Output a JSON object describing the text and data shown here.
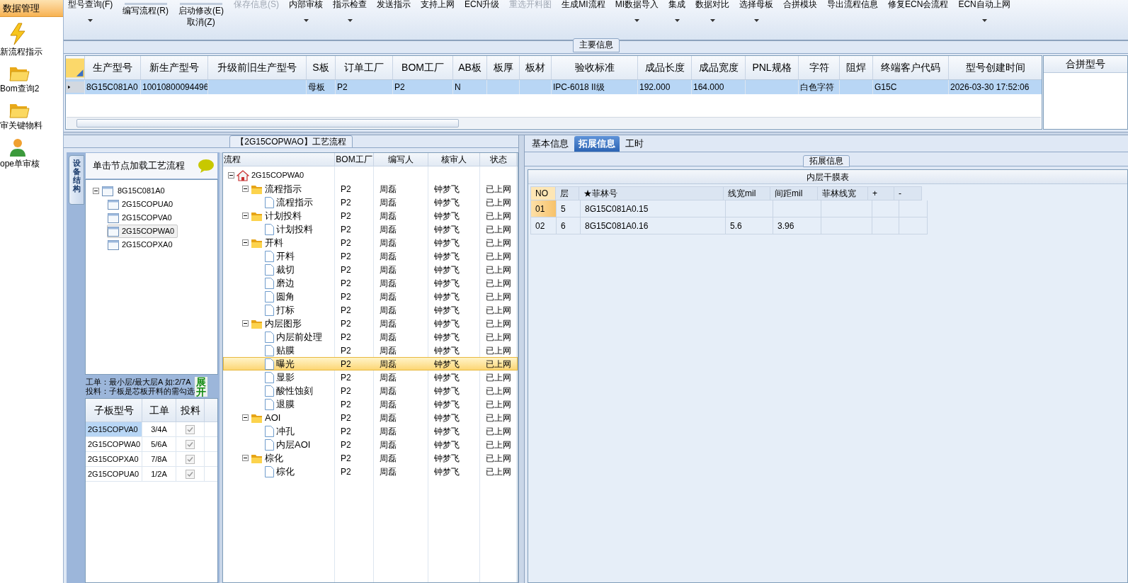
{
  "sidebar": {
    "header": "数据管理",
    "items": [
      {
        "label": "新流程指示"
      },
      {
        "label": "Bom查询2"
      },
      {
        "label": "审关键物料"
      },
      {
        "label": "ope单审核"
      }
    ]
  },
  "toolbar": [
    {
      "kind": "top",
      "label": "型号查询(F)",
      "dropdown": true,
      "disabled": false
    },
    {
      "kind": "mid",
      "lines": [
        "编写流程(R)"
      ],
      "dropdown": false,
      "disabled": false
    },
    {
      "kind": "mid",
      "lines": [
        "启动修改(E)",
        "取消(Z)"
      ],
      "dropdown": false,
      "disabled": false
    },
    {
      "kind": "top",
      "label": "保存信息(S)",
      "dropdown": false,
      "disabled": true
    },
    {
      "kind": "top",
      "label": "内部审核",
      "dropdown": true,
      "disabled": false
    },
    {
      "kind": "top",
      "label": "指示检查",
      "dropdown": true,
      "disabled": false
    },
    {
      "kind": "top",
      "label": "发送指示",
      "dropdown": false,
      "disabled": false
    },
    {
      "kind": "top",
      "label": "支持上网",
      "dropdown": false,
      "disabled": false
    },
    {
      "kind": "top",
      "label": "ECN升级",
      "dropdown": false,
      "disabled": false
    },
    {
      "kind": "top",
      "label": "重选开料图",
      "dropdown": false,
      "disabled": true
    },
    {
      "kind": "top",
      "label": "生成MI流程",
      "dropdown": false,
      "disabled": false
    },
    {
      "kind": "top",
      "label": "MI数据导入",
      "dropdown": true,
      "disabled": false
    },
    {
      "kind": "top",
      "label": "集成",
      "dropdown": true,
      "disabled": false
    },
    {
      "kind": "top",
      "label": "数据对比",
      "dropdown": true,
      "disabled": false
    },
    {
      "kind": "top",
      "label": "选择母板",
      "dropdown": true,
      "disabled": false
    },
    {
      "kind": "top",
      "label": "合拼模块",
      "dropdown": false,
      "disabled": false
    },
    {
      "kind": "top",
      "label": "导出流程信息",
      "dropdown": false,
      "disabled": false
    },
    {
      "kind": "top",
      "label": "修复ECN会流程",
      "dropdown": false,
      "disabled": false
    },
    {
      "kind": "top",
      "label": "ECN自动上网",
      "dropdown": true,
      "disabled": false
    }
  ],
  "main_info": {
    "title": "主要信息",
    "columns": [
      "生产型号",
      "新生产型号",
      "升级前旧生产型号",
      "S板",
      "订单工厂",
      "BOM工厂",
      "AB板",
      "板厚",
      "板材",
      "验收标准",
      "成品长度",
      "成品宽度",
      "PNL规格",
      "字符",
      "阻焊",
      "终端客户代码",
      "型号创建时间"
    ],
    "rows": [
      {
        "selected": true,
        "cells": [
          "8G15C081A0",
          "10010800094496",
          "",
          "母板",
          "P2",
          "P2",
          "N",
          "",
          "",
          "IPC-6018 II级",
          "192.000",
          "164.000",
          "",
          "白色字符",
          "",
          "G15C",
          "2026-03-30 17:52:06"
        ]
      }
    ],
    "side_title": "合拼型号"
  },
  "flow_panel": {
    "title": "【2G15COPWAO】工艺流程",
    "side_tab": "设备结构",
    "hint": "单击节点加载工艺流程",
    "tree": {
      "label": "8G15C081A0",
      "expanded": true,
      "children": [
        {
          "label": "2G15COPUA0",
          "selected": false
        },
        {
          "label": "2G15COPVA0",
          "selected": false
        },
        {
          "label": "2G15COPWA0",
          "selected": true
        },
        {
          "label": "2G15COPXA0",
          "selected": false
        }
      ]
    },
    "notes": [
      "工单：最小层/最大层A 如:2/7A",
      "投料：子板是芯板开料的需勾选"
    ],
    "expand_button": "展开",
    "sub_columns": [
      "子板型号",
      "工单",
      "投料"
    ],
    "sub_rows": [
      {
        "board": "2G15COPVA0",
        "order": "3/4A",
        "checked": true,
        "selected": true
      },
      {
        "board": "2G15COPWA0",
        "order": "5/6A",
        "checked": true,
        "selected": false
      },
      {
        "board": "2G15COPXA0",
        "order": "7/8A",
        "checked": true,
        "selected": false
      },
      {
        "board": "2G15COPUA0",
        "order": "1/2A",
        "checked": true,
        "selected": false
      }
    ],
    "flow_columns": [
      "流程",
      "BOM工厂",
      "编写人",
      "核审人",
      "状态"
    ],
    "flow_root": {
      "label": "2G15COPWA0",
      "expanded": true,
      "children": [
        {
          "label": "流程指示",
          "bom": "P2",
          "writer": "周磊",
          "reviewer": "钟梦飞",
          "status": "已上网",
          "expanded": true,
          "children": [
            {
              "label": "流程指示",
              "bom": "P2",
              "writer": "周磊",
              "reviewer": "钟梦飞",
              "status": "已上网",
              "selected": false
            }
          ]
        },
        {
          "label": "计划投料",
          "bom": "P2",
          "writer": "周磊",
          "reviewer": "钟梦飞",
          "status": "已上网",
          "expanded": true,
          "children": [
            {
              "label": "计划投料",
              "bom": "P2",
              "writer": "周磊",
              "reviewer": "钟梦飞",
              "status": "已上网",
              "selected": false
            }
          ]
        },
        {
          "label": "开料",
          "bom": "P2",
          "writer": "周磊",
          "reviewer": "钟梦飞",
          "status": "已上网",
          "expanded": true,
          "children": [
            {
              "label": "开料",
              "bom": "P2",
              "writer": "周磊",
              "reviewer": "钟梦飞",
              "status": "已上网",
              "selected": false
            },
            {
              "label": "裁切",
              "bom": "P2",
              "writer": "周磊",
              "reviewer": "钟梦飞",
              "status": "已上网",
              "selected": false
            },
            {
              "label": "磨边",
              "bom": "P2",
              "writer": "周磊",
              "reviewer": "钟梦飞",
              "status": "已上网",
              "selected": false
            },
            {
              "label": "圆角",
              "bom": "P2",
              "writer": "周磊",
              "reviewer": "钟梦飞",
              "status": "已上网",
              "selected": false
            },
            {
              "label": "打标",
              "bom": "P2",
              "writer": "周磊",
              "reviewer": "钟梦飞",
              "status": "已上网",
              "selected": false
            }
          ]
        },
        {
          "label": "内层图形",
          "bom": "P2",
          "writer": "周磊",
          "reviewer": "钟梦飞",
          "status": "已上网",
          "expanded": true,
          "children": [
            {
              "label": "内层前处理",
              "bom": "P2",
              "writer": "周磊",
              "reviewer": "钟梦飞",
              "status": "已上网",
              "selected": false
            },
            {
              "label": "贴膜",
              "bom": "P2",
              "writer": "周磊",
              "reviewer": "钟梦飞",
              "status": "已上网",
              "selected": false
            },
            {
              "label": "曝光",
              "bom": "P2",
              "writer": "周磊",
              "reviewer": "钟梦飞",
              "status": "已上网",
              "selected": true
            },
            {
              "label": "显影",
              "bom": "P2",
              "writer": "周磊",
              "reviewer": "钟梦飞",
              "status": "已上网",
              "selected": false
            },
            {
              "label": "酸性蚀刻",
              "bom": "P2",
              "writer": "周磊",
              "reviewer": "钟梦飞",
              "status": "已上网",
              "selected": false
            },
            {
              "label": "退膜",
              "bom": "P2",
              "writer": "周磊",
              "reviewer": "钟梦飞",
              "status": "已上网",
              "selected": false
            }
          ]
        },
        {
          "label": "AOI",
          "bom": "P2",
          "writer": "周磊",
          "reviewer": "钟梦飞",
          "status": "已上网",
          "expanded": true,
          "children": [
            {
              "label": "冲孔",
              "bom": "P2",
              "writer": "周磊",
              "reviewer": "钟梦飞",
              "status": "已上网",
              "selected": false
            },
            {
              "label": "内层AOI",
              "bom": "P2",
              "writer": "周磊",
              "reviewer": "钟梦飞",
              "status": "已上网",
              "selected": false
            }
          ]
        },
        {
          "label": "棕化",
          "bom": "P2",
          "writer": "周磊",
          "reviewer": "钟梦飞",
          "status": "已上网",
          "expanded": true,
          "children": [
            {
              "label": "棕化",
              "bom": "P2",
              "writer": "周磊",
              "reviewer": "钟梦飞",
              "status": "已上网",
              "selected": false
            }
          ]
        }
      ]
    }
  },
  "detail_panel": {
    "tabs": [
      {
        "label": "基本信息",
        "selected": false
      },
      {
        "label": "拓展信息",
        "selected": true
      },
      {
        "label": "工时",
        "selected": false
      }
    ],
    "group_title": "拓展信息",
    "table_title": "内层干膜表",
    "columns": [
      "NO",
      "层",
      "★菲林号",
      "线宽mil",
      "间距mil",
      "菲林线宽",
      "+",
      "-"
    ],
    "rows": [
      {
        "selected": true,
        "cells": [
          "01",
          "5",
          "8G15C081A0.15",
          "",
          "",
          "",
          "",
          ""
        ]
      },
      {
        "selected": false,
        "cells": [
          "02",
          "6",
          "8G15C081A0.16",
          "5.6",
          "3.96",
          "",
          "",
          ""
        ]
      }
    ]
  }
}
